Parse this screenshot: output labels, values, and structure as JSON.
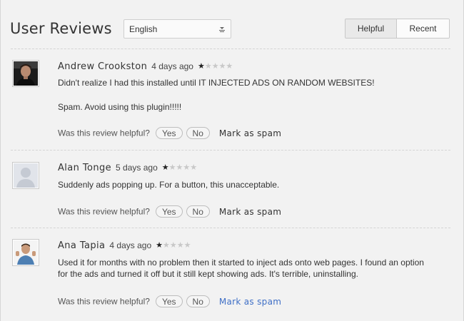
{
  "header": {
    "title": "User Reviews",
    "language": "English",
    "sort": {
      "helpful_label": "Helpful",
      "recent_label": "Recent",
      "active": "Helpful"
    }
  },
  "reviews": [
    {
      "author": "Andrew Crookston",
      "when": "4 days ago",
      "rating": 1,
      "max_rating": 5,
      "paragraphs": [
        "Didn't realize I had this installed until IT INJECTED ADS ON RANDOM WEBSITES!",
        "Spam. Avoid using this plugin!!!!!"
      ],
      "helpful_prompt": "Was this review helpful?",
      "yes_label": "Yes",
      "no_label": "No",
      "spam_label": "Mark as spam",
      "avatar": "photo-dark"
    },
    {
      "author": "Alan Tonge",
      "when": "5 days ago",
      "rating": 1,
      "max_rating": 5,
      "paragraphs": [
        "Suddenly ads popping up. For a button, this unacceptable."
      ],
      "helpful_prompt": "Was this review helpful?",
      "yes_label": "Yes",
      "no_label": "No",
      "spam_label": "Mark as spam",
      "avatar": "default-silhouette"
    },
    {
      "author": "Ana Tapia",
      "when": "4 days ago",
      "rating": 1,
      "max_rating": 5,
      "paragraphs": [
        "Used it for months with no problem then it started to inject ads onto web pages. I found an option for the ads and turned it off but it still kept showing ads. It's terrible, uninstalling."
      ],
      "helpful_prompt": "Was this review helpful?",
      "yes_label": "Yes",
      "no_label": "No",
      "spam_label": "Mark as spam",
      "avatar": "photo-light"
    }
  ],
  "colors": {
    "background": "#f2f2f2",
    "link_hover": "#3f6fc6",
    "star_filled": "#222222",
    "star_empty": "#c8c8c8"
  }
}
